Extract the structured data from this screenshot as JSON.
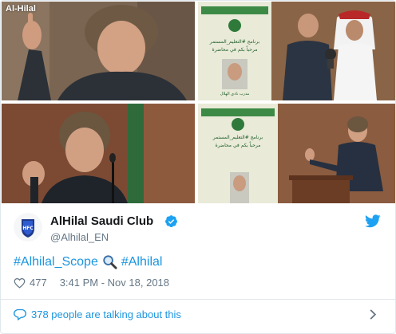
{
  "photos": {
    "watermark": "Al-Hilal",
    "banner_line1": "برنامج #التعليم_المستمر",
    "banner_line2": "مرحباً بكم في محاضرة",
    "banner_caption": "مدرب نادي الهلال"
  },
  "author": {
    "name": "AlHilal Saudi Club",
    "handle": "@Alhilal_EN",
    "verified": true
  },
  "tweet": {
    "hashtag1": "#Alhilal_Scope",
    "hashtag2": "#Alhilal",
    "emoji": "magnifying-glass"
  },
  "meta": {
    "likes": "477",
    "timestamp": "3:41 PM - Nov 18, 2018"
  },
  "footer": {
    "talking": "378 people are talking about this"
  },
  "colors": {
    "link": "#1b95e0",
    "muted": "#657786",
    "border": "#e1e8ed",
    "twitter_blue": "#1da1f2"
  }
}
